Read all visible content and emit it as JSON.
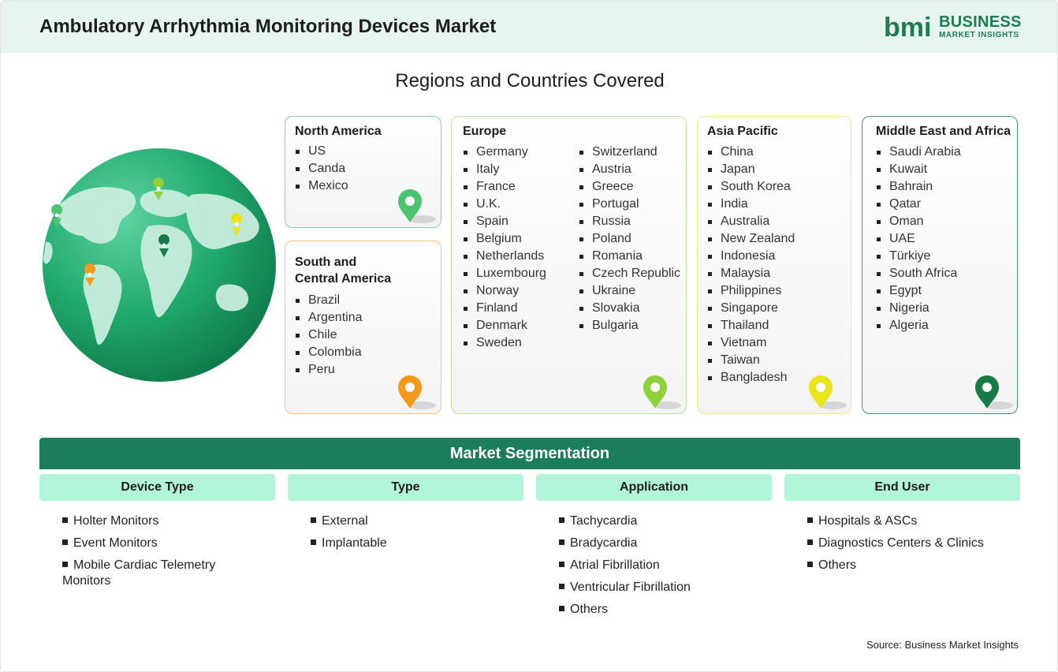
{
  "header": {
    "title": "Ambulatory Arrhythmia Monitoring Devices Market",
    "logo_line1": "BUSINESS",
    "logo_line2": "MARKET INSIGHTS",
    "logo_mark_text": "bmi"
  },
  "regions": {
    "title": "Regions and Countries Covered",
    "north_america": {
      "title": "North America",
      "items": [
        "US",
        "Canda",
        "Mexico"
      ],
      "color": "#7ed6a0"
    },
    "south_central_america": {
      "title_line1": "South and",
      "title_line2": "Central America",
      "items": [
        "Brazil",
        "Argentina",
        "Chile",
        "Colombia",
        "Peru"
      ],
      "color": "#f5c27a"
    },
    "europe": {
      "title": "Europe",
      "col1": [
        "Germany",
        "Italy",
        "France",
        "U.K.",
        "Spain",
        "Belgium",
        "Netherlands",
        "Luxembourg",
        "Norway",
        "Finland",
        "Denmark",
        "Sweden"
      ],
      "col2": [
        "Switzerland",
        "Austria",
        "Greece",
        "Portugal",
        "Russia",
        "Poland",
        "Romania",
        "Czech Republic",
        "Ukraine",
        "Slovakia",
        "Bulgaria"
      ],
      "color": "#b9e79a"
    },
    "asia_pacific": {
      "title": "Asia Pacific",
      "items": [
        "China",
        "Japan",
        "South Korea",
        "India",
        "Australia",
        "New Zealand",
        "Indonesia",
        "Malaysia",
        "Philippines",
        "Singapore",
        "Thailand",
        "Vietnam",
        "Taiwan",
        "Bangladesh"
      ],
      "color": "#eeec7f"
    },
    "middle_east_africa": {
      "title": "Middle East and Africa",
      "items": [
        "Saudi Arabia",
        "Kuwait",
        "Bahrain",
        "Qatar",
        "Oman",
        "UAE",
        "Türkiye",
        "South Africa",
        "Egypt",
        "Nigeria",
        "Algeria"
      ],
      "color": "#3c9a6c"
    }
  },
  "pins": {
    "north_america": "#4cc36e",
    "south_central_america": "#f39a1e",
    "europe": "#8fd13a",
    "asia_pacific": "#e8e51b",
    "middle_east_africa": "#177a44"
  },
  "segmentation": {
    "title": "Market Segmentation",
    "columns": [
      {
        "title": "Device Type",
        "items": [
          "Holter Monitors",
          "Event Monitors",
          "Mobile Cardiac Telemetry Monitors"
        ]
      },
      {
        "title": "Type",
        "items": [
          "External",
          "Implantable"
        ]
      },
      {
        "title": "Application",
        "items": [
          "Tachycardia",
          "Bradycardia",
          "Atrial Fibrillation",
          "Ventricular Fibrillation",
          "Others"
        ]
      },
      {
        "title": "End User",
        "items": [
          "Hospitals & ASCs",
          "Diagnostics Centers & Clinics",
          "Others"
        ]
      }
    ]
  },
  "source": "Source: Business Market Insights"
}
